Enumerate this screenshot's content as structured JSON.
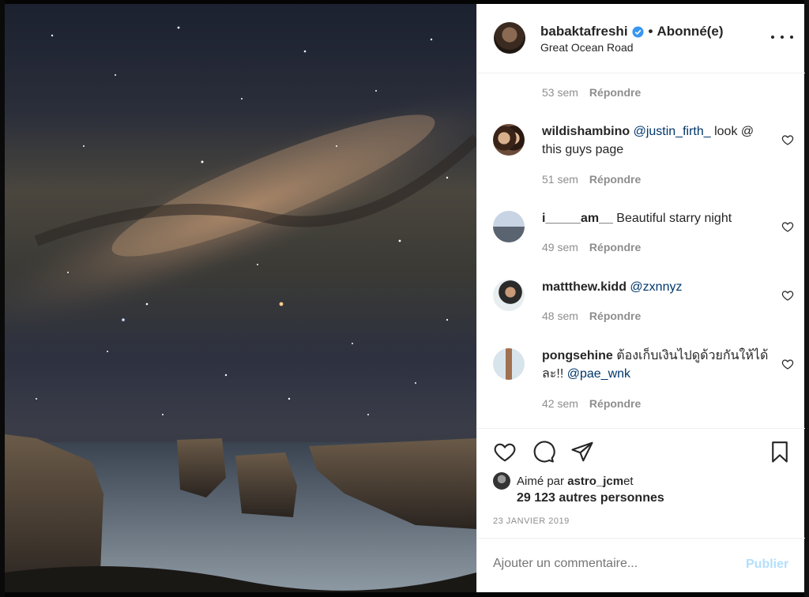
{
  "post": {
    "username": "babaktafreshi",
    "follow_status": "Abonné(e)",
    "location": "Great Ocean Road",
    "separator": "•"
  },
  "comments": [
    {
      "user": "",
      "text": "",
      "time": "53 sem",
      "reply": "Répondre"
    },
    {
      "user": "wildishambino",
      "mention": "@justin_firth_",
      "text": " look @ this guys page",
      "time": "51 sem",
      "reply": "Répondre"
    },
    {
      "user": "i_____am__",
      "text": " Beautiful starry night",
      "time": "49 sem",
      "reply": "Répondre"
    },
    {
      "user": "mattthew.kidd",
      "mention": "@zxnnyz",
      "text": "",
      "time": "48 sem",
      "reply": "Répondre"
    },
    {
      "user": "pongsehine",
      "text": " ต้องเก็บเงินไปดูด้วยกันให้ได้ละ!! ",
      "mention": "@pae_wnk",
      "time": "42 sem",
      "reply": "Répondre"
    }
  ],
  "likes": {
    "prefix": "Aimé par ",
    "user": "astro_jcm",
    "suffix": " et",
    "others": "29 123 autres personnes"
  },
  "date": "23 JANVIER 2019",
  "input": {
    "placeholder": "Ajouter un commentaire...",
    "publish": "Publier"
  },
  "colors": {
    "verified_blue": "#3897f0",
    "mention": "#00376b",
    "muted": "#8e8e8e",
    "publish_disabled": "#b2dffc"
  },
  "icons": {
    "verified": "verified-badge-icon",
    "more": "more-options-icon",
    "like": "heart-icon",
    "comment": "comment-icon",
    "share": "share-icon",
    "save": "bookmark-icon"
  }
}
